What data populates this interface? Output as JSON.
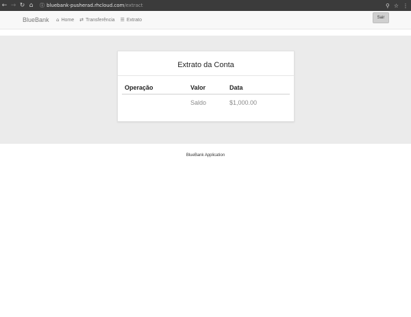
{
  "browser": {
    "url_domain": "bluebank-pusherad.rhcloud.com",
    "url_path": "/extract",
    "icons": [
      "back-icon",
      "forward-icon",
      "reload-icon",
      "home-icon",
      "info-icon",
      "extension-icon",
      "star-icon",
      "menu-icon"
    ]
  },
  "navbar": {
    "brand": "BlueBank",
    "links": [
      {
        "icon": "home-icon",
        "glyph": "⌂",
        "label": "Home"
      },
      {
        "icon": "transfer-icon",
        "glyph": "⇄",
        "label": "Transferência"
      },
      {
        "icon": "list-icon",
        "glyph": "☰",
        "label": "Extrato"
      }
    ],
    "logout_label": "Sair"
  },
  "panel": {
    "title": "Extrato da Conta",
    "columns": [
      "Operação",
      "Valor",
      "Data"
    ],
    "rows": [
      [
        "",
        "Saldo",
        "$1,000.00"
      ]
    ]
  },
  "footer": {
    "text": "BlueBank Application"
  }
}
